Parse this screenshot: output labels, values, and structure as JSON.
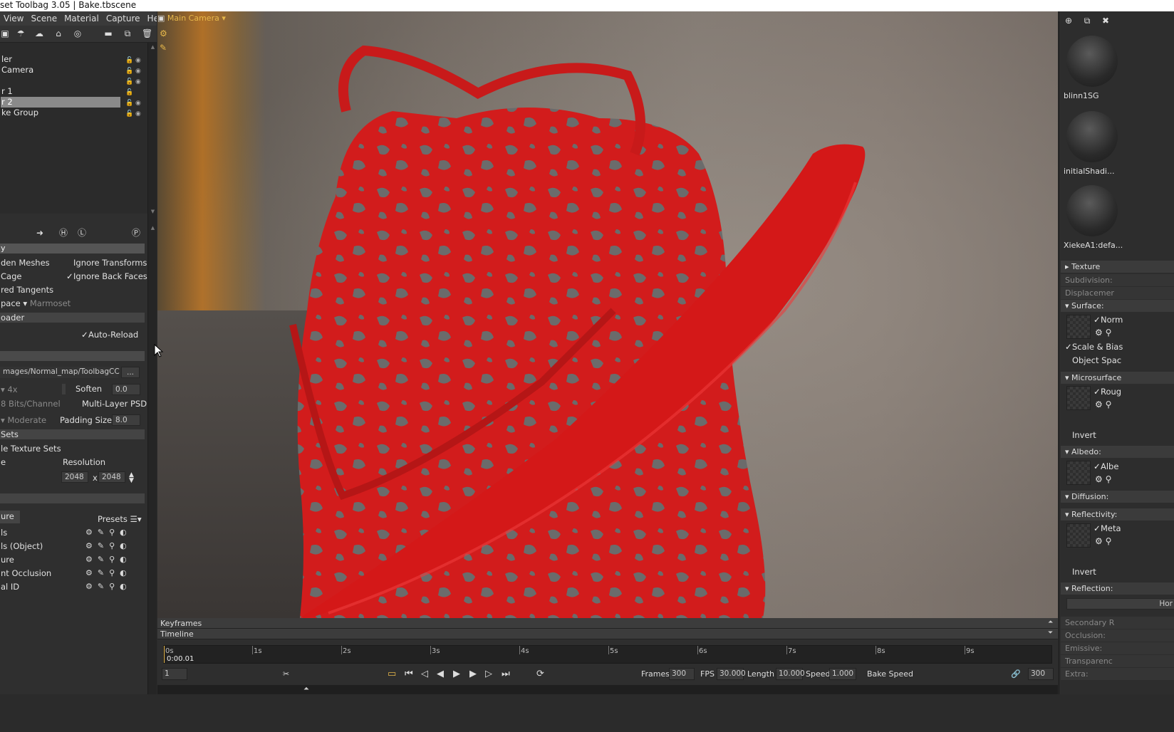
{
  "window": {
    "title": "set Toolbag 3.05  |  Bake.tbscene"
  },
  "menu": [
    "View",
    "Scene",
    "Material",
    "Capture",
    "Help"
  ],
  "outliner": {
    "items": [
      {
        "label": "ler",
        "selected": false
      },
      {
        "label": " Camera",
        "selected": false
      },
      {
        "label": "",
        "selected": false
      },
      {
        "label": "r 1",
        "selected": false
      },
      {
        "label": "r 2",
        "selected": true
      },
      {
        "label": "ke Group",
        "selected": false
      }
    ]
  },
  "panel": {
    "header_section": "y",
    "hidden_meshes": "den Meshes",
    "ignore_transforms": "Ignore Transforms",
    "cage": " Cage",
    "ignore_back_faces": "Ignore Back Faces",
    "stored_tangents": "red Tangents",
    "space_label": "pace",
    "space_value": "Marmoset",
    "loader_label": "oader",
    "auto_reload": "Auto-Reload",
    "output_path": "mages/Normal_map/ToolbagCC",
    "browse": "...",
    "samples": "4x",
    "soften_label": "Soften",
    "soften_value": "0.0",
    "bits": "8 Bits/Channel",
    "multilayer": "Multi-Layer PSD",
    "quality": "Moderate",
    "padding_label": "Padding Size:",
    "padding_value": "8.0",
    "sets_section": " Sets",
    "texture_sets": "le Texture Sets",
    "res_col1": "e",
    "resolution_label": "Resolution",
    "res_w": "2048",
    "res_x": "x",
    "res_h": "2048",
    "maps_section": "ure",
    "presets": "Presets",
    "maps": [
      "ls",
      "ls (Object)",
      "ure",
      "nt Occlusion",
      "al ID"
    ]
  },
  "viewport": {
    "camera": "Main Camera"
  },
  "materials": {
    "names": [
      "blinn1SG",
      "initialShadi...",
      "XiekeA1:defa..."
    ],
    "sections": {
      "texture": "Texture",
      "subdivision": "Subdivision:",
      "displacement": "Displacemer",
      "surface": "Surface:",
      "norm": "Norm",
      "scale_bias": "Scale & Bias",
      "object_space": "Object Spac",
      "microsurface": "Microsurface",
      "roug": "Roug",
      "invert": "Invert",
      "albedo": "Albedo:",
      "albe": "Albe",
      "diffusion": "Diffusion:",
      "reflectivity": "Reflectivity:",
      "meta": "Meta",
      "invert2": "Invert",
      "reflection": "Reflection:",
      "hor": "Hor",
      "secondary": "Secondary R",
      "occlusion": "Occlusion:",
      "emissive": "Emissive:",
      "transparency": "Transparenc",
      "extra": "Extra:"
    }
  },
  "timeline": {
    "keyframes": "Keyframes",
    "timeline": "Timeline",
    "ticks": [
      "0s",
      "1s",
      "2s",
      "3s",
      "4s",
      "5s",
      "6s",
      "7s",
      "8s",
      "9s"
    ],
    "current_time": "0:00.01",
    "frame": "1",
    "frames_label": "Frames",
    "frames": "300",
    "fps_label": "FPS",
    "fps": "30.000",
    "length_label": "Length",
    "length": "10.000",
    "speed_label": "Speed",
    "speed": "1.000",
    "bake_speed": "Bake Speed",
    "end_frame": "300"
  },
  "colors": {
    "accent": "#e8b84a",
    "selection": "#8a8a8a",
    "mesh_red": "#d91f1f",
    "mesh_gray": "#6b6b6b"
  }
}
